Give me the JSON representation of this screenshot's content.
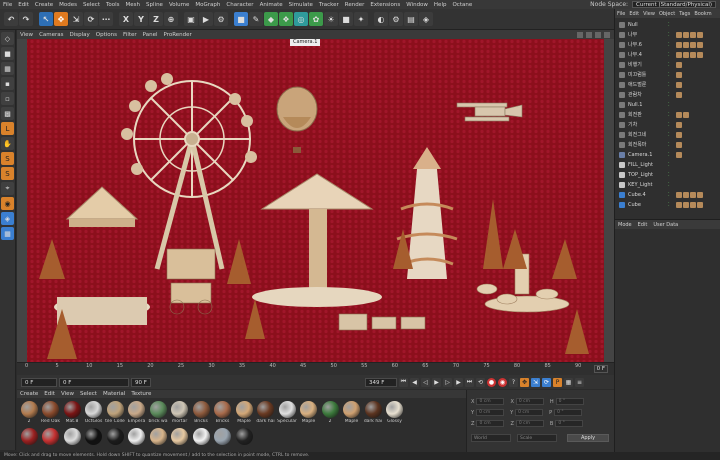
{
  "menubar": {
    "items": [
      "File",
      "Edit",
      "Create",
      "Modes",
      "Select",
      "Tools",
      "Mesh",
      "Spline",
      "Volume",
      "MoGraph",
      "Character",
      "Animate",
      "Simulate",
      "Tracker",
      "Render",
      "Extensions",
      "Window",
      "Help",
      "Octane"
    ],
    "node_space_label": "Node Space:",
    "layout_value": "Current (Standard/Physical)"
  },
  "toolbar": {
    "axis_x": "X",
    "axis_y": "Y",
    "axis_z": "Z"
  },
  "viewport_menu": {
    "items": [
      "View",
      "Cameras",
      "Display",
      "Options",
      "Filter",
      "Panel",
      "ProRender"
    ],
    "camera_label": "Camera.1"
  },
  "timeline": {
    "ticks": [
      "0",
      "5",
      "10",
      "15",
      "20",
      "25",
      "30",
      "35",
      "40",
      "45",
      "50",
      "55",
      "60",
      "65",
      "70",
      "75",
      "80",
      "85",
      "90"
    ],
    "frame_indicator": "0 F"
  },
  "transport": {
    "start_field": "0 F",
    "current_field": "0 F",
    "end_field": "90 F",
    "max_field": "349 F"
  },
  "material_menu": {
    "items": [
      "Create",
      "Edit",
      "View",
      "Select",
      "Material",
      "Texture"
    ]
  },
  "materials": [
    {
      "name": "2",
      "color": "#b27b4e"
    },
    {
      "name": "Red Oak",
      "color": "#8a4a2c"
    },
    {
      "name": "Mat.8",
      "color": "#7a1414"
    },
    {
      "name": "OctGlos",
      "color": "#d8d8d8"
    },
    {
      "name": "tile Colle",
      "color": "#bfa27a"
    },
    {
      "name": "Empera",
      "color": "#c9a989"
    },
    {
      "name": "brick wa",
      "color": "#5a8a5a"
    },
    {
      "name": "mortar",
      "color": "#cfc6b5"
    },
    {
      "name": "Bricks",
      "color": "#8e5a3c"
    },
    {
      "name": "Bricks",
      "color": "#a86a4a"
    },
    {
      "name": "Maple",
      "color": "#d4a877"
    },
    {
      "name": "dark hai",
      "color": "#6a3a22"
    },
    {
      "name": "Specular",
      "color": "#e0e0e0"
    },
    {
      "name": "Maple",
      "color": "#d9b080"
    },
    {
      "name": "2",
      "color": "#3c7a3c"
    },
    {
      "name": "Maple",
      "color": "#cfa070"
    },
    {
      "name": "dark hai",
      "color": "#5c3420"
    },
    {
      "name": "Glossy",
      "color": "#e8e0d0"
    },
    {
      "name": "",
      "color": "#9b2020"
    },
    {
      "name": "",
      "color": "#c43030"
    },
    {
      "name": "",
      "color": "#dcdcdc"
    },
    {
      "name": "",
      "color": "#111111"
    },
    {
      "name": "",
      "color": "#1c1c1c"
    },
    {
      "name": "",
      "color": "#eeeeee"
    },
    {
      "name": "",
      "color": "#d8b48a"
    },
    {
      "name": "",
      "color": "#e7c9a1"
    },
    {
      "name": "",
      "color": "#f2f2f2"
    },
    {
      "name": "",
      "color": "#9aa5b0"
    },
    {
      "name": "",
      "color": "#222222"
    }
  ],
  "coords": {
    "rows": [
      {
        "a": "X",
        "a_val": "0 cm",
        "b": "X",
        "b_val": "0 cm",
        "c": "H",
        "c_val": "0 °"
      },
      {
        "a": "Y",
        "a_val": "0 cm",
        "b": "Y",
        "b_val": "0 cm",
        "c": "P",
        "c_val": "0 °"
      },
      {
        "a": "Z",
        "a_val": "0 cm",
        "b": "Z",
        "b_val": "0 cm",
        "c": "B",
        "c_val": "0 °"
      }
    ],
    "world_label": "World",
    "scale_label": "Scale",
    "apply_label": "Apply"
  },
  "object_panel": {
    "menu": [
      "File",
      "Edit",
      "View",
      "Object",
      "Tags",
      "Bookm"
    ],
    "objects": [
      {
        "name": "Null",
        "icon": "null-icon",
        "tags": 0
      },
      {
        "name": "나무",
        "icon": "null-icon",
        "tags": 4
      },
      {
        "name": "나무.6",
        "icon": "null-icon",
        "tags": 4
      },
      {
        "name": "나무.4",
        "icon": "null-icon",
        "tags": 4
      },
      {
        "name": "비행기",
        "icon": "null-icon",
        "tags": 1
      },
      {
        "name": "미끄럼틀",
        "icon": "null-icon",
        "tags": 1
      },
      {
        "name": "애드벌룬",
        "icon": "null-icon",
        "tags": 1
      },
      {
        "name": "관람차",
        "icon": "null-icon",
        "tags": 1
      },
      {
        "name": "Null.1",
        "icon": "null-icon",
        "tags": 0
      },
      {
        "name": "회전판",
        "icon": "null-icon",
        "tags": 2
      },
      {
        "name": "기차",
        "icon": "null-icon",
        "tags": 1
      },
      {
        "name": "회전그네",
        "icon": "null-icon",
        "tags": 1
      },
      {
        "name": "회전목마",
        "icon": "null-icon",
        "tags": 1
      },
      {
        "name": "Camera.1",
        "icon": "camera-icon",
        "tags": 1
      },
      {
        "name": "FILL_Light",
        "icon": "light-icon",
        "tags": 0
      },
      {
        "name": "TOP_Light",
        "icon": "light-icon",
        "tags": 0
      },
      {
        "name": "KEY_Light",
        "icon": "light-icon",
        "tags": 0
      },
      {
        "name": "Cube.4",
        "icon": "cube-icon",
        "tags": 4
      },
      {
        "name": "Cube",
        "icon": "cube-icon",
        "tags": 4
      }
    ]
  },
  "attr_panel": {
    "menu": [
      "Mode",
      "Edit",
      "User Data"
    ]
  },
  "status": "Move: Click and drag to move elements. Hold down SHIFT to quantize movement / add to the selection in point mode, CTRL to remove."
}
